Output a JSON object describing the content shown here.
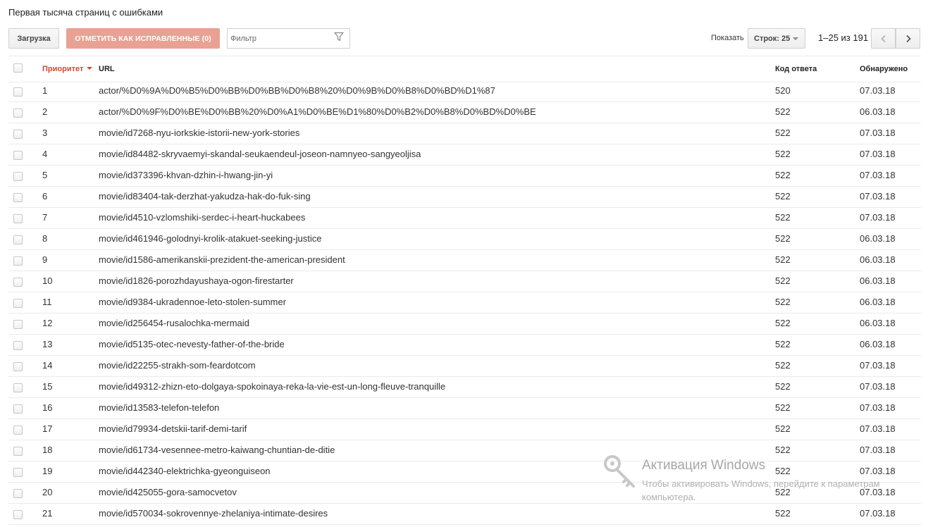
{
  "page": {
    "title": "Первая тысяча страниц с ошибками"
  },
  "toolbar": {
    "upload_label": "Загрузка",
    "mark_fixed_label": "ОТМЕТИТЬ КАК ИСПРАВЛЕННЫЕ (0)",
    "filter_placeholder": "Фильтр",
    "show_label": "Показать",
    "rows_select_label": "Строк: 25",
    "page_info": "1–25 из 191"
  },
  "table": {
    "columns": {
      "priority": "Приоритет",
      "url": "URL",
      "code": "Код ответа",
      "detected": "Обнаружено"
    },
    "rows": [
      {
        "priority": "1",
        "url": "actor/%D0%9A%D0%B5%D0%BB%D0%BB%D0%B8%20%D0%9B%D0%B8%D0%BD%D1%87",
        "code": "520",
        "date": "07.03.18"
      },
      {
        "priority": "2",
        "url": "actor/%D0%9F%D0%BE%D0%BB%20%D0%A1%D0%BE%D1%80%D0%B2%D0%B8%D0%BD%D0%BE",
        "code": "522",
        "date": "06.03.18"
      },
      {
        "priority": "3",
        "url": "movie/id7268-nyu-iorkskie-istorii-new-york-stories",
        "code": "522",
        "date": "07.03.18"
      },
      {
        "priority": "4",
        "url": "movie/id84482-skryvaemyi-skandal-seukaendeul-joseon-namnyeo-sangyeoljisa",
        "code": "522",
        "date": "07.03.18"
      },
      {
        "priority": "5",
        "url": "movie/id373396-khvan-dzhin-i-hwang-jin-yi",
        "code": "522",
        "date": "07.03.18"
      },
      {
        "priority": "6",
        "url": "movie/id83404-tak-derzhat-yakudza-hak-do-fuk-sing",
        "code": "522",
        "date": "07.03.18"
      },
      {
        "priority": "7",
        "url": "movie/id4510-vzlomshiki-serdec-i-heart-huckabees",
        "code": "522",
        "date": "07.03.18"
      },
      {
        "priority": "8",
        "url": "movie/id461946-golodnyi-krolik-atakuet-seeking-justice",
        "code": "522",
        "date": "06.03.18"
      },
      {
        "priority": "9",
        "url": "movie/id1586-amerikanskii-prezident-the-american-president",
        "code": "522",
        "date": "06.03.18"
      },
      {
        "priority": "10",
        "url": "movie/id1826-porozhdayushaya-ogon-firestarter",
        "code": "522",
        "date": "06.03.18"
      },
      {
        "priority": "11",
        "url": "movie/id9384-ukradennoe-leto-stolen-summer",
        "code": "522",
        "date": "06.03.18"
      },
      {
        "priority": "12",
        "url": "movie/id256454-rusalochka-mermaid",
        "code": "522",
        "date": "06.03.18"
      },
      {
        "priority": "13",
        "url": "movie/id5135-otec-nevesty-father-of-the-bride",
        "code": "522",
        "date": "06.03.18"
      },
      {
        "priority": "14",
        "url": "movie/id22255-strakh-som-feardotcom",
        "code": "522",
        "date": "07.03.18"
      },
      {
        "priority": "15",
        "url": "movie/id49312-zhizn-eto-dolgaya-spokoinaya-reka-la-vie-est-un-long-fleuve-tranquille",
        "code": "522",
        "date": "07.03.18"
      },
      {
        "priority": "16",
        "url": "movie/id13583-telefon-telefon",
        "code": "522",
        "date": "07.03.18"
      },
      {
        "priority": "17",
        "url": "movie/id79934-detskii-tarif-demi-tarif",
        "code": "522",
        "date": "07.03.18"
      },
      {
        "priority": "18",
        "url": "movie/id61734-vesennee-metro-kaiwang-chuntian-de-ditie",
        "code": "522",
        "date": "07.03.18"
      },
      {
        "priority": "19",
        "url": "movie/id442340-elektrichka-gyeonguiseon",
        "code": "522",
        "date": "07.03.18"
      },
      {
        "priority": "20",
        "url": "movie/id425055-gora-samocvetov",
        "code": "522",
        "date": "07.03.18"
      },
      {
        "priority": "21",
        "url": "movie/id570034-sokrovennye-zhelaniya-intimate-desires",
        "code": "522",
        "date": "07.03.18"
      }
    ]
  },
  "watermark": {
    "title": "Активация Windows",
    "subtitle": "Чтобы активировать Windows, перейдите к параметрам компьютера."
  },
  "icons": {
    "filter": "filter-icon",
    "prev": "chevron-left-icon",
    "next": "chevron-right-icon",
    "sort": "sort-desc-icon",
    "watermark": "key-icon"
  },
  "colors": {
    "accent": "#d14836",
    "mark_button": "#e9a194"
  }
}
